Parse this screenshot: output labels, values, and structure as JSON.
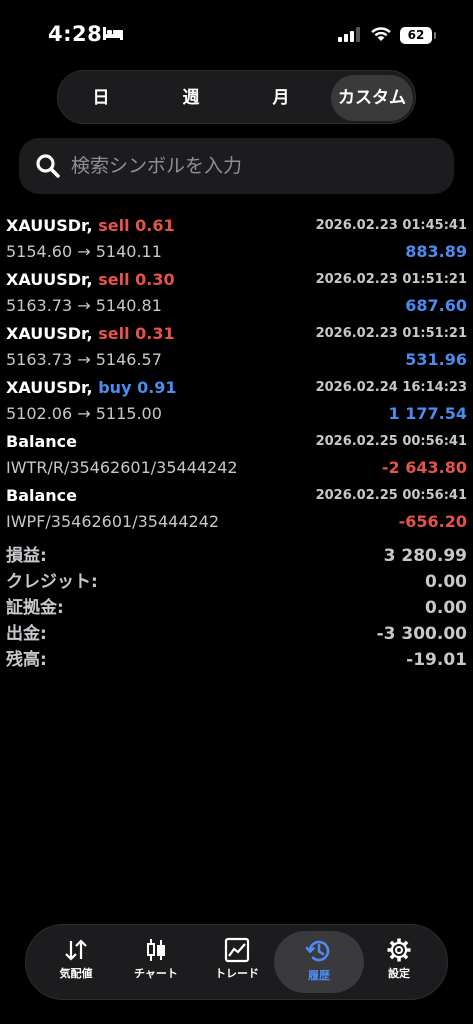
{
  "status": {
    "time": "4:28",
    "battery": "62"
  },
  "periods": [
    "日",
    "週",
    "月",
    "カスタム"
  ],
  "selected_period": "カスタム",
  "search": {
    "placeholder": "検索シンボルを入力"
  },
  "trades": [
    {
      "symbol": "XAUUSDr,",
      "side": "sell",
      "volume": "0.61",
      "datetime": "2026.02.23 01:45:41",
      "prices": "5154.60 → 5140.11",
      "profit": "883.89",
      "profit_color": "positive"
    },
    {
      "symbol": "XAUUSDr,",
      "side": "sell",
      "volume": "0.30",
      "datetime": "2026.02.23 01:51:21",
      "prices": "5163.73 → 5140.81",
      "profit": "687.60",
      "profit_color": "positive"
    },
    {
      "symbol": "XAUUSDr,",
      "side": "sell",
      "volume": "0.31",
      "datetime": "2026.02.23 01:51:21",
      "prices": "5163.73 → 5146.57",
      "profit": "531.96",
      "profit_color": "positive"
    },
    {
      "symbol": "XAUUSDr,",
      "side": "buy",
      "volume": "0.91",
      "datetime": "2026.02.24 16:14:23",
      "prices": "5102.06 → 5115.00",
      "profit": "1 177.54",
      "profit_color": "positive"
    },
    {
      "symbol": "Balance",
      "side": "",
      "volume": "",
      "datetime": "2026.02.25 00:56:41",
      "prices": "IWTR/R/35462601/35444242",
      "profit": "-2 643.80",
      "profit_color": "negative"
    },
    {
      "symbol": "Balance",
      "side": "",
      "volume": "",
      "datetime": "2026.02.25 00:56:41",
      "prices": "IWPF/35462601/35444242",
      "profit": "-656.20",
      "profit_color": "negative"
    }
  ],
  "summary": [
    {
      "label": "損益:",
      "value": "3 280.99"
    },
    {
      "label": "クレジット:",
      "value": "0.00"
    },
    {
      "label": "証拠金:",
      "value": "0.00"
    },
    {
      "label": "出金:",
      "value": "-3 300.00"
    },
    {
      "label": "残高:",
      "value": "-19.01"
    }
  ],
  "tabs": [
    {
      "label": "気配値",
      "icon": "quotes-arrows-icon"
    },
    {
      "label": "チャート",
      "icon": "candlestick-chart-icon"
    },
    {
      "label": "トレード",
      "icon": "trade-line-chart-icon"
    },
    {
      "label": "履歴",
      "icon": "history-clock-icon"
    },
    {
      "label": "設定",
      "icon": "settings-gear-icon"
    }
  ],
  "active_tab": "履歴",
  "colors": {
    "positive": "#4d8bf0",
    "negative": "#e5534b",
    "accent": "#4d8bf0"
  }
}
